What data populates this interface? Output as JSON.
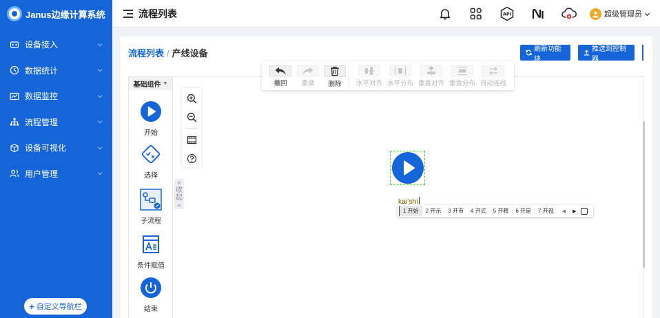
{
  "app": {
    "title": "Janus边缘计算系统"
  },
  "sidebar": {
    "items": [
      {
        "label": "设备接入",
        "icon": "device-access-icon"
      },
      {
        "label": "数据统计",
        "icon": "clock-icon"
      },
      {
        "label": "数据监控",
        "icon": "monitor-icon"
      },
      {
        "label": "流程管理",
        "icon": "flow-tree-icon"
      },
      {
        "label": "设备可视化",
        "icon": "visual-icon"
      },
      {
        "label": "用户管理",
        "icon": "users-icon"
      }
    ],
    "custom_nav_label": "自定义导航栏"
  },
  "header": {
    "title": "流程列表",
    "icons": [
      "bell-icon",
      "apps-icon",
      "api-icon",
      "ni-icon",
      "cloud-warning-icon"
    ],
    "api_text": "API",
    "user_name": "超级管理员"
  },
  "breadcrumb": {
    "parent": "流程列表",
    "separator": "/",
    "current": "产线设备"
  },
  "actions": {
    "refresh_label": "刷新功能块",
    "push_label": "推送到控制器"
  },
  "palette": {
    "header": "基础组件",
    "items": [
      {
        "label": "开始"
      },
      {
        "label": "选择"
      },
      {
        "label": "子流程"
      },
      {
        "label": "条件赋值"
      },
      {
        "label": "结束"
      }
    ],
    "collapse_label": [
      "收",
      "起"
    ]
  },
  "toolbar": {
    "undo": "撤回",
    "redo": "重做",
    "delete": "删除",
    "align_h": "水平对齐",
    "dist_h": "水平分布",
    "align_v": "垂直对齐",
    "dist_v": "垂直分布",
    "auto_connect": "自动连线"
  },
  "ime": {
    "composition": "kai'shi",
    "candidates": [
      "1 开始",
      "2 开示",
      "3 开市",
      "4 开式",
      "5 开释",
      "6 开是",
      "7 开视"
    ]
  },
  "colors": {
    "primary": "#1565d8",
    "node_selected_border": "#3bd43b"
  }
}
